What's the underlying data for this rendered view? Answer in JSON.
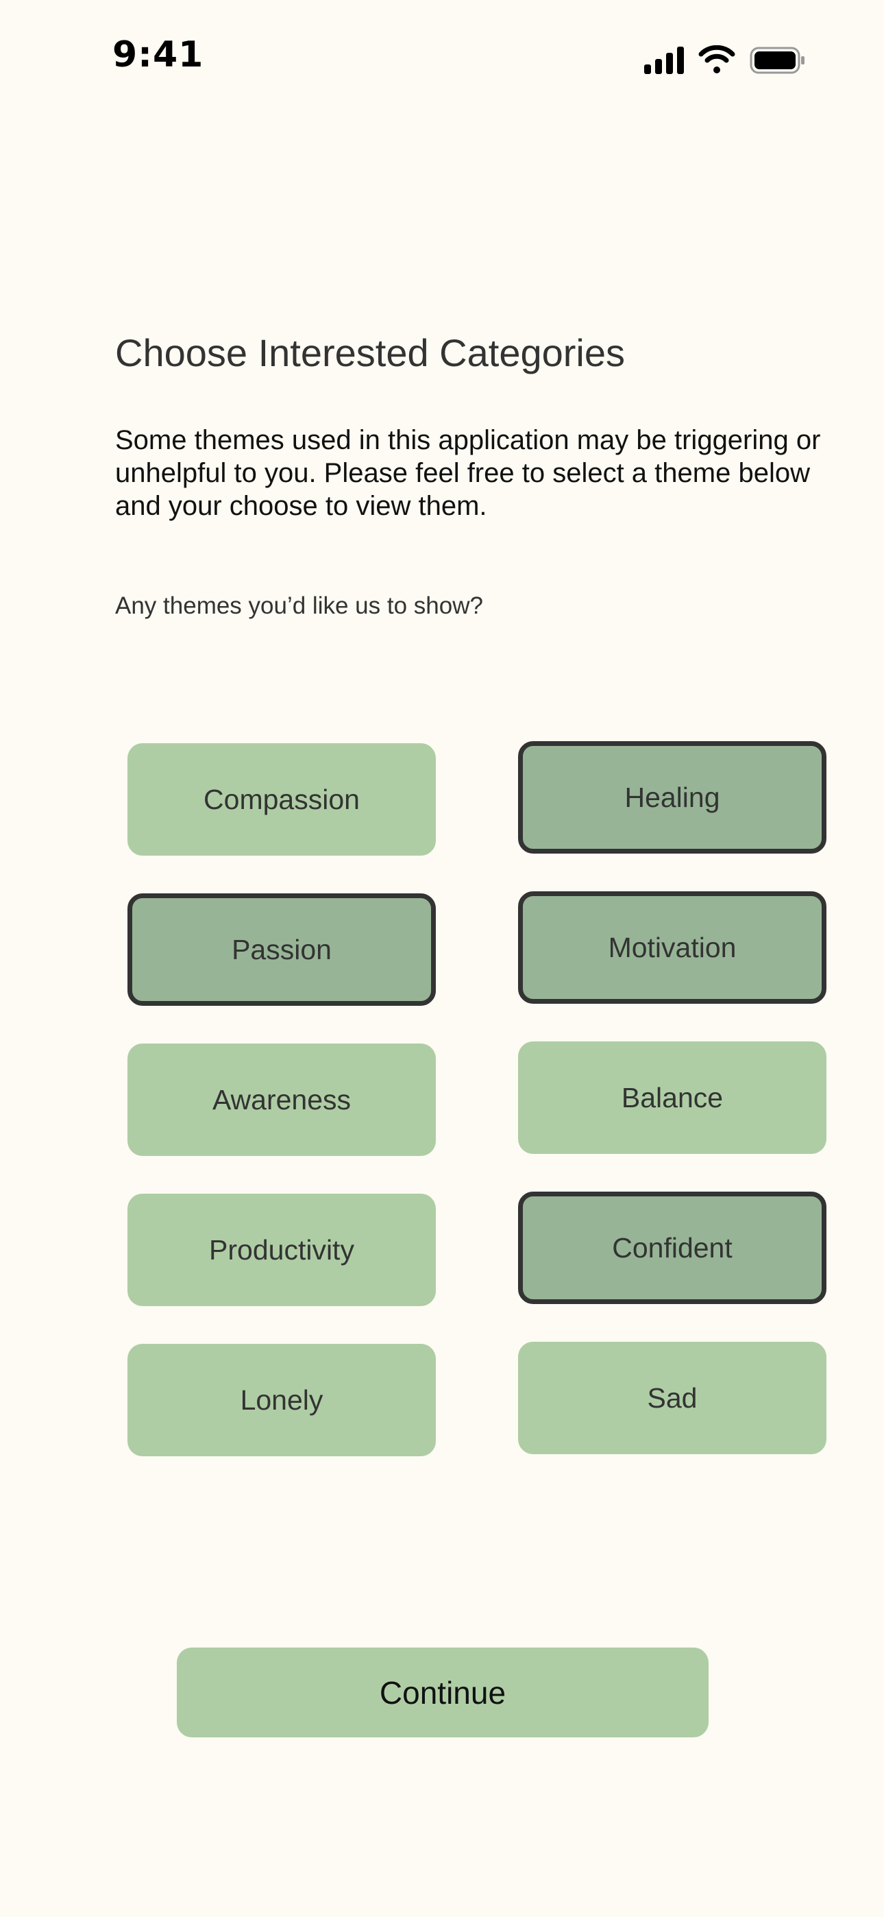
{
  "status_bar": {
    "time": "9:41",
    "icons": [
      "cellular-signal-icon",
      "wifi-icon",
      "battery-icon"
    ]
  },
  "header": {
    "title": "Choose Interested Categories",
    "intro": "Some themes used in this application may be triggering or unhelpful to you. Please feel free to select a theme below and your choose to view them.",
    "question": "Any themes you’d like us to show?"
  },
  "categories": [
    {
      "label": "Compassion",
      "selected": false
    },
    {
      "label": "Healing",
      "selected": true
    },
    {
      "label": "Passion",
      "selected": true
    },
    {
      "label": "Motivation",
      "selected": true
    },
    {
      "label": "Awareness",
      "selected": false
    },
    {
      "label": "Balance",
      "selected": false
    },
    {
      "label": "Productivity",
      "selected": false
    },
    {
      "label": "Confident",
      "selected": true
    },
    {
      "label": "Lonely",
      "selected": false
    },
    {
      "label": "Sad",
      "selected": false
    }
  ],
  "actions": {
    "continue_label": "Continue"
  },
  "colors": {
    "background": "#fdfbf3",
    "chip": "#aecda4",
    "chip_selected": "#97b596",
    "selected_border": "#333333",
    "text": "#333333"
  }
}
